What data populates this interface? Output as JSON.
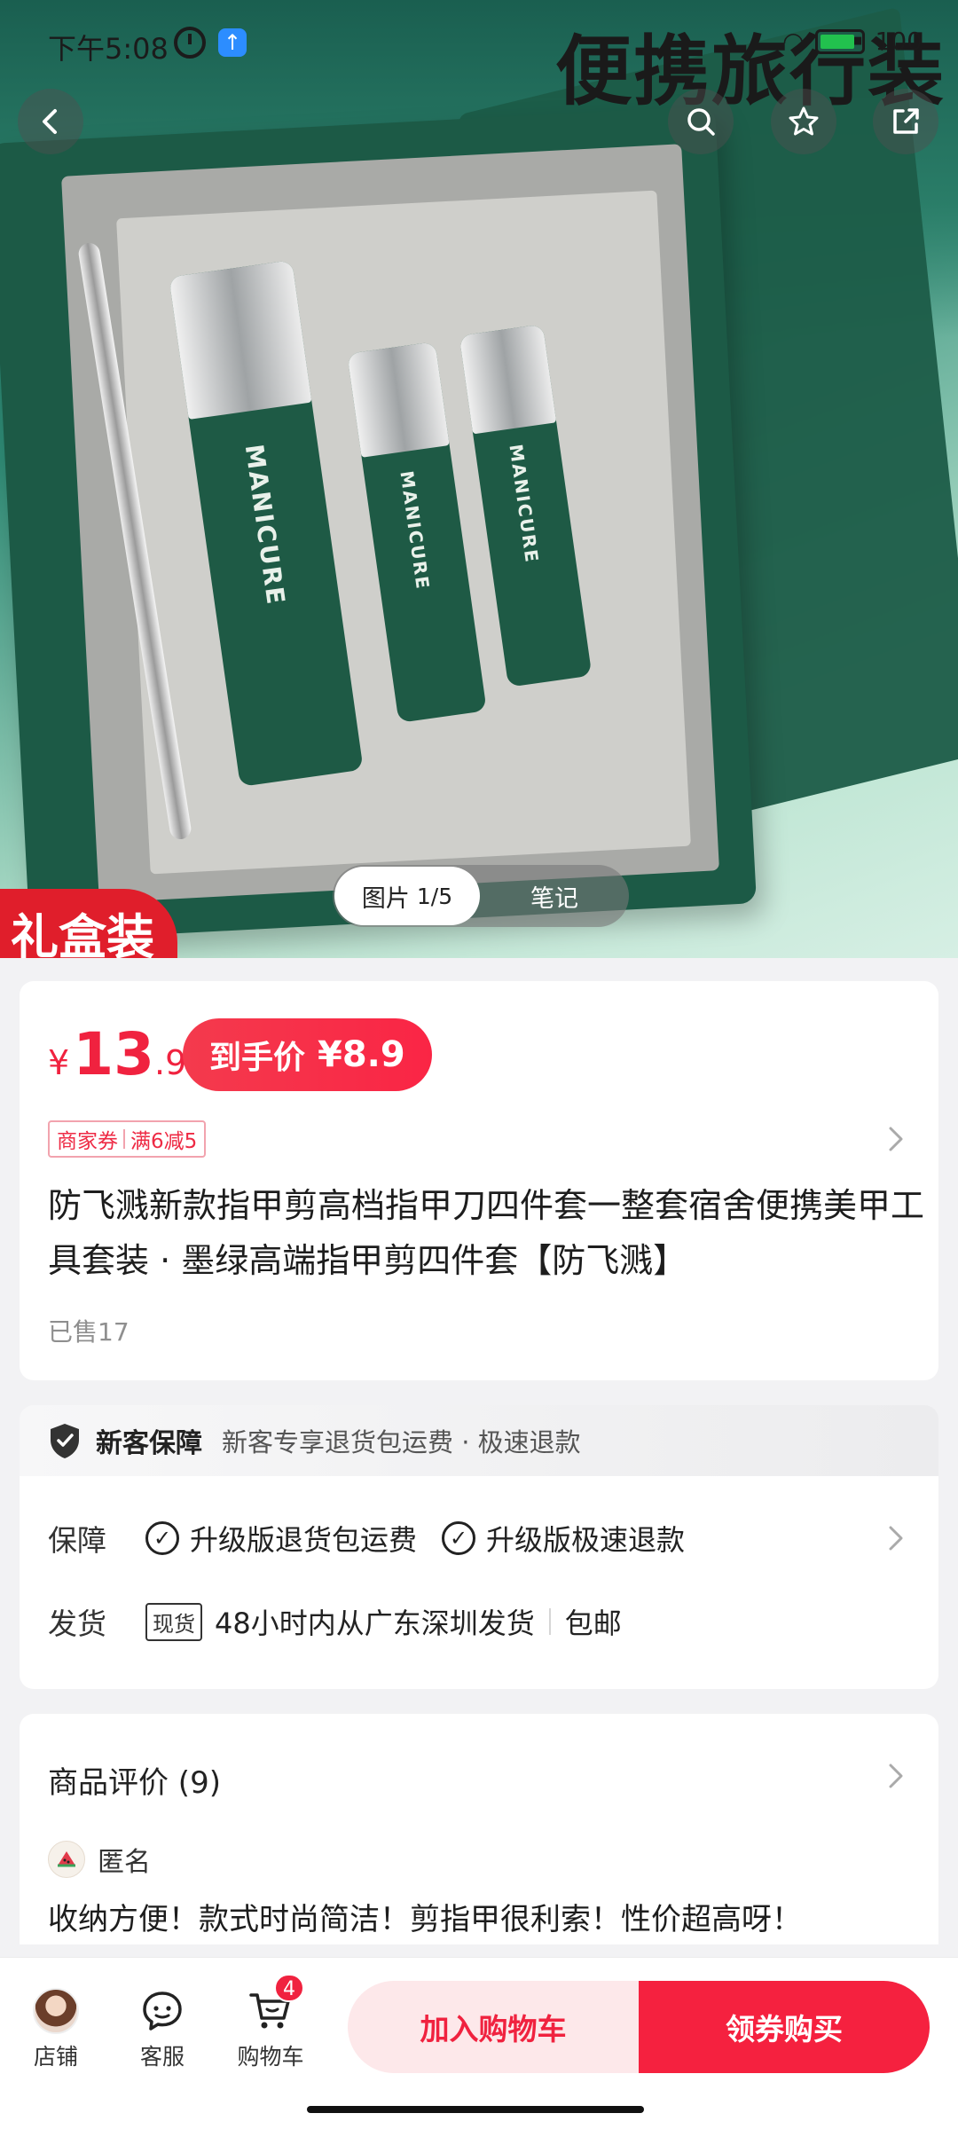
{
  "status_bar": {
    "time": "下午5:08",
    "battery": "100"
  },
  "hero": {
    "headline": "便携旅行装",
    "gift_tag": "礼盒装",
    "product_print": "MANICURE",
    "toggle": {
      "active_label": "图片",
      "active_counter": "1/5",
      "inactive_label": "笔记"
    }
  },
  "header_icons": [
    "back-icon",
    "search-icon",
    "star-icon",
    "share-icon"
  ],
  "price": {
    "symbol": "¥",
    "integer": "13",
    "decimal": ".9",
    "final_label": "到手价",
    "final_amount": "¥8.9"
  },
  "coupon": {
    "label": "商家券",
    "rule": "满6减5"
  },
  "product": {
    "title": "防飞溅新款指甲剪高档指甲刀四件套一整套宿舍便携美甲工具套装 · 墨绿高端指甲剪四件套【防飞溅】",
    "sold": "已售17"
  },
  "guarantee_strip": {
    "title": "新客保障",
    "subtitle": "新客专享退货包运费 · 极速退款"
  },
  "service": {
    "guarantee_label": "保障",
    "guarantee_items": [
      "升级版退货包运费",
      "升级版极速退款"
    ],
    "shipping_label": "发货",
    "stock_tag": "现货",
    "shipping_text": "48小时内从广东深圳发货",
    "shipping_free": "包邮"
  },
  "reviews": {
    "header": "商品评价 (9)",
    "user": "匿名",
    "text": "收纳方便！款式时尚简洁！剪指甲很利索！性价超高呀！"
  },
  "bottom_bar": {
    "shop_label": "店铺",
    "service_label": "客服",
    "cart_label": "购物车",
    "cart_count": "4",
    "add_to_cart": "加入购物车",
    "buy_now": "领券购买"
  },
  "colors": {
    "accent": "#f0223f",
    "accent_light": "#fde8ea",
    "box_green": "#1c5a46"
  }
}
